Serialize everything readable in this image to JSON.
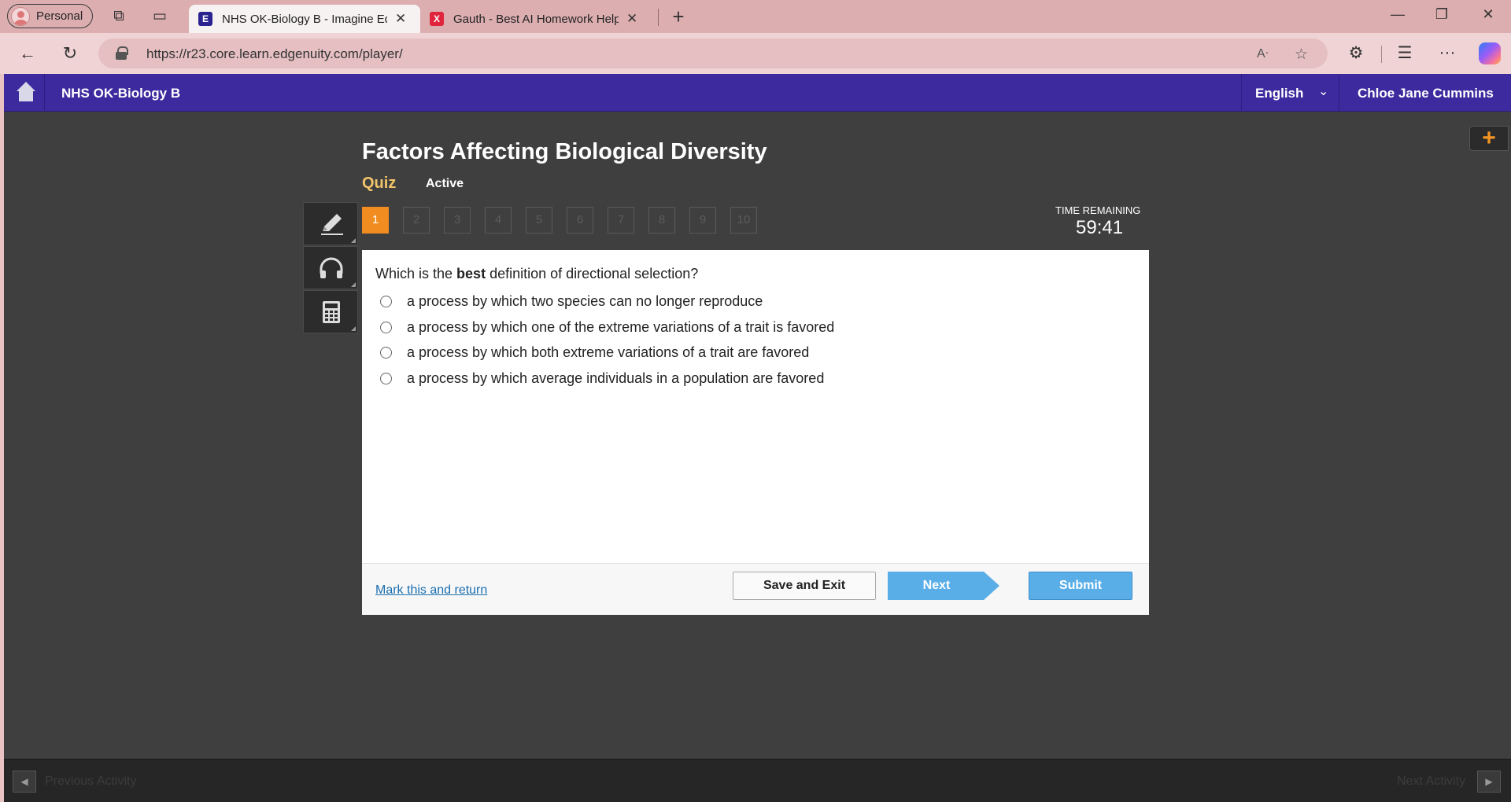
{
  "browser": {
    "profile_label": "Personal",
    "tabs": [
      {
        "title": "NHS OK-Biology B - Imagine Edgenuity",
        "favicon": "E",
        "color": "#2a2290",
        "active": true
      },
      {
        "title": "Gauth - Best AI Homework Helper",
        "favicon": "X",
        "color": "#e0243c",
        "active": false
      }
    ],
    "url": "https://r23.core.learn.edgenuity.com/player/"
  },
  "header": {
    "course_title": "NHS OK-Biology B",
    "language": "English",
    "user_name": "Chloe Jane Cummins"
  },
  "activity": {
    "title": "Factors Affecting Biological Diversity",
    "type": "Quiz",
    "status": "Active",
    "question_numbers": [
      "1",
      "2",
      "3",
      "4",
      "5",
      "6",
      "7",
      "8",
      "9",
      "10"
    ],
    "current_question": 1,
    "time_label": "TIME REMAINING",
    "time_value": "59:41"
  },
  "question": {
    "prefix": "Which is the ",
    "bold": "best",
    "suffix": " definition of directional selection?",
    "choices": [
      "a process by which two species can no longer reproduce",
      "a process by which one of the extreme variations of a trait is favored",
      "a process by which both extreme variations of a trait are favored",
      "a process by which average individuals in a population are favored"
    ]
  },
  "footer": {
    "mark_link": "Mark this and return",
    "save_label": "Save and Exit",
    "next_label": "Next",
    "submit_label": "Submit"
  },
  "bottom_nav": {
    "previous": "Previous Activity",
    "next": "Next Activity"
  },
  "colors": {
    "nav_purple": "#3c2a9e",
    "accent_orange": "#f18d20",
    "button_blue": "#5aaee8"
  }
}
